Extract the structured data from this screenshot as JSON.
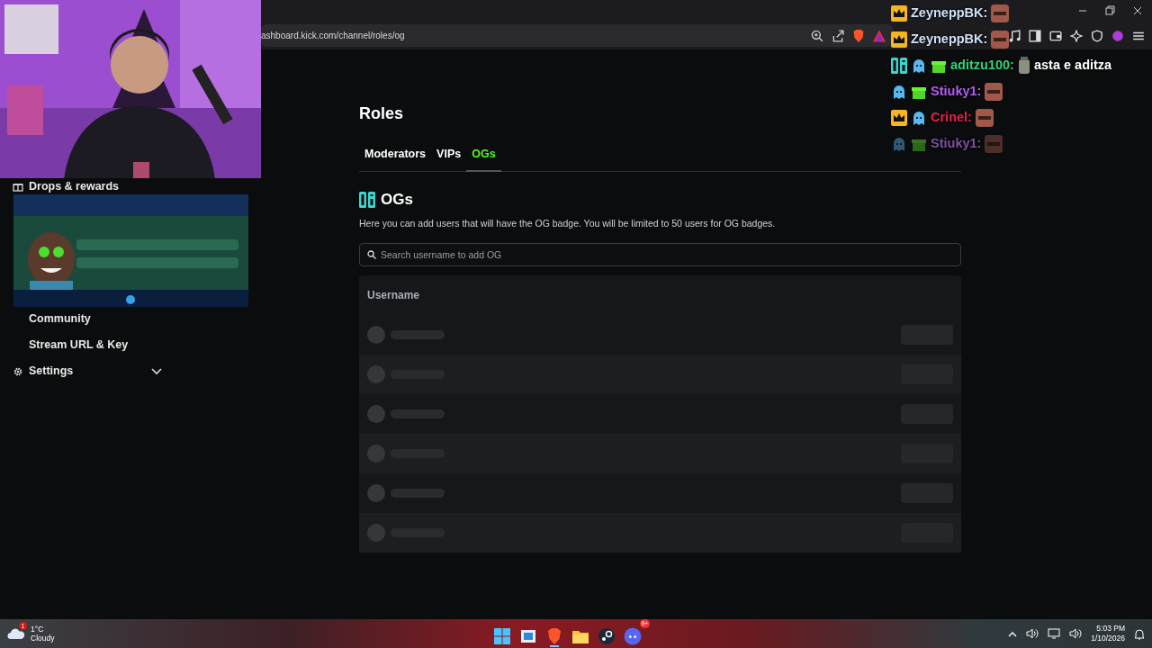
{
  "browser": {
    "url": "ashboard.kick.com/channel/roles/og"
  },
  "sidebar": {
    "items": [
      {
        "label": "Drops & rewards",
        "kind": "icon"
      },
      {
        "label": "Community",
        "kind": "plain"
      },
      {
        "label": "Stream URL & Key",
        "kind": "plain"
      },
      {
        "label": "Settings",
        "kind": "group",
        "expanded": false
      }
    ]
  },
  "page": {
    "title": "Roles",
    "tabs": [
      {
        "label": "Moderators",
        "selected": false
      },
      {
        "label": "VIPs",
        "selected": false
      },
      {
        "label": "OGs",
        "selected": true
      }
    ],
    "section": {
      "title": "OGs",
      "description": "Here you can add users that will have the OG badge. You will be limited to 50 users for OG badges.",
      "search": {
        "placeholder": "Search username to add OG"
      }
    },
    "table": {
      "columns": [
        "Username"
      ],
      "rows": [
        {
          "kind": "skeleton"
        },
        {
          "kind": "skeleton"
        },
        {
          "kind": "skeleton"
        },
        {
          "kind": "skeleton"
        },
        {
          "kind": "skeleton"
        },
        {
          "kind": "skeleton"
        }
      ]
    }
  },
  "chat": {
    "messages": [
      {
        "user": "ZeyneppBK:",
        "color": "#cfe0f8",
        "badges": [
          {
            "kind": "crown"
          }
        ],
        "emote": true,
        "faded": false
      },
      {
        "user": "ZeyneppBK:",
        "color": "#cfe0f8",
        "badges": [
          {
            "kind": "crown"
          }
        ],
        "emote": true,
        "faded": false
      },
      {
        "user": "aditzu100:",
        "color": "#2bd67b",
        "badges": [
          {
            "kind": "og"
          },
          {
            "kind": "ghost"
          },
          {
            "kind": "gift"
          }
        ],
        "text": "asta e aditza",
        "emote": true,
        "faded": false
      },
      {
        "user": "Stiuky1:",
        "color": "#b45cf2",
        "badges": [
          {
            "kind": "ghost"
          },
          {
            "kind": "gift"
          }
        ],
        "emote": true,
        "faded": false
      },
      {
        "user": "Crinel:",
        "color": "#e3224f",
        "badges": [
          {
            "kind": "crown"
          },
          {
            "kind": "ghost"
          }
        ],
        "emote": true,
        "faded": false
      },
      {
        "user": "Stiuky1:",
        "color": "#7a52a0",
        "badges": [
          {
            "kind": "ghost"
          },
          {
            "kind": "gift"
          }
        ],
        "emote": true,
        "faded": true
      }
    ]
  },
  "taskbar": {
    "weather": {
      "temperature": "1°C",
      "condition": "Cloudy",
      "badge": "1"
    },
    "apps": [
      {
        "kind": "start"
      },
      {
        "kind": "window"
      },
      {
        "kind": "browser",
        "active": true
      },
      {
        "kind": "folder"
      },
      {
        "kind": "steam"
      },
      {
        "kind": "discord",
        "badge": "9+"
      }
    ],
    "time": "5:03 PM",
    "date": "1/10/2026"
  }
}
